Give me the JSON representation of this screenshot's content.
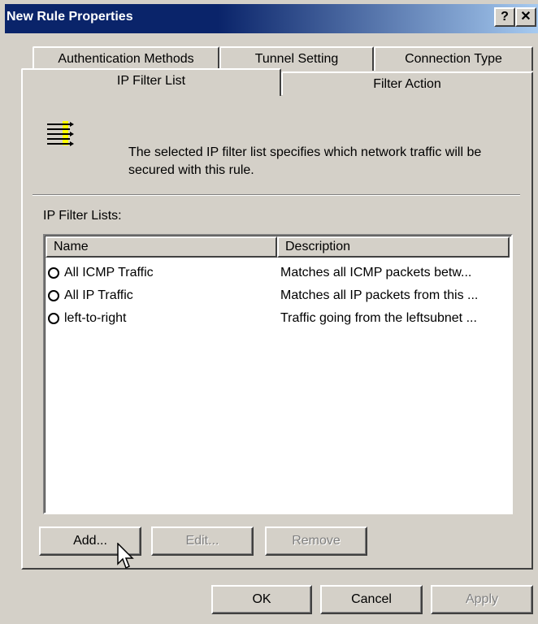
{
  "window": {
    "title": "New Rule Properties",
    "help_label": "?",
    "close_label": "✕"
  },
  "tabs": {
    "row1": [
      "Authentication Methods",
      "Tunnel Setting",
      "Connection Type"
    ],
    "row2": [
      "IP Filter List",
      "Filter Action"
    ],
    "active": "IP Filter List"
  },
  "panel": {
    "description": "The selected IP filter list specifies which network traffic will be secured with this rule.",
    "lists_label": "IP Filter Lists:",
    "columns": [
      "Name",
      "Description"
    ],
    "rows": [
      {
        "name": "All ICMP Traffic",
        "description": "Matches all ICMP packets betw..."
      },
      {
        "name": "All IP Traffic",
        "description": "Matches all IP packets from this ..."
      },
      {
        "name": "left-to-right",
        "description": "Traffic going from the leftsubnet ..."
      }
    ],
    "buttons": {
      "add": "Add...",
      "edit": "Edit...",
      "remove": "Remove"
    }
  },
  "footer": {
    "ok": "OK",
    "cancel": "Cancel",
    "apply": "Apply"
  },
  "colors": {
    "title_bar": "#0a246a",
    "face": "#d4d0c8",
    "filter_icon_accent": "#ffff00"
  },
  "icons": [
    "filter-list-icon",
    "mouse-pointer-icon"
  ]
}
